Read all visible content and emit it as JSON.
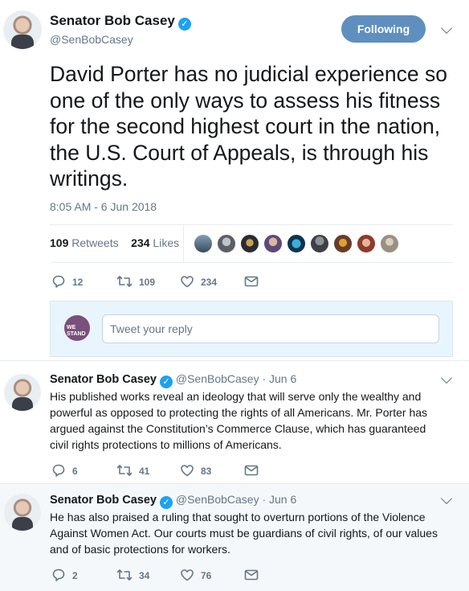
{
  "main_tweet": {
    "author_name": "Senator Bob Casey",
    "author_handle": "@SenBobCasey",
    "follow_label": "Following",
    "text": "David Porter has no judicial experience so one of the only ways to assess his fitness for the second highest court in the nation, the U.S. Court of Appeals, is through his writings.",
    "timestamp": "8:05 AM - 6 Jun 2018",
    "retweets_count": "109",
    "retweets_label": "Retweets",
    "likes_count": "234",
    "likes_label": "Likes",
    "actions": {
      "replies": "12",
      "retweets": "109",
      "likes": "234"
    }
  },
  "reply_box": {
    "placeholder": "Tweet your reply",
    "avatar_text": "WE STAND"
  },
  "thread": [
    {
      "author_name": "Senator Bob Casey",
      "author_handle": "@SenBobCasey",
      "date": "· Jun 6",
      "text": "His published works reveal an ideology that will serve only the wealthy and powerful as opposed to protecting the rights of all Americans. Mr. Porter has argued against the Constitution’s Commerce Clause, which has guaranteed civil rights protections to millions of Americans.",
      "actions": {
        "replies": "6",
        "retweets": "41",
        "likes": "83"
      }
    },
    {
      "author_name": "Senator Bob Casey",
      "author_handle": "@SenBobCasey",
      "date": "· Jun 6",
      "text": "He has also praised a ruling that sought to overturn portions of the Violence Against Women Act. Our courts must be guardians of civil rights, of our values and of basic protections for workers.",
      "actions": {
        "replies": "2",
        "retweets": "34",
        "likes": "76"
      }
    }
  ],
  "colors": {
    "accent": "#1da1f2",
    "following_button": "#5f8fbf",
    "muted_text": "#657786",
    "reply_box_bg": "#e8f5fd",
    "highlight_bg": "#f5f8fa"
  }
}
